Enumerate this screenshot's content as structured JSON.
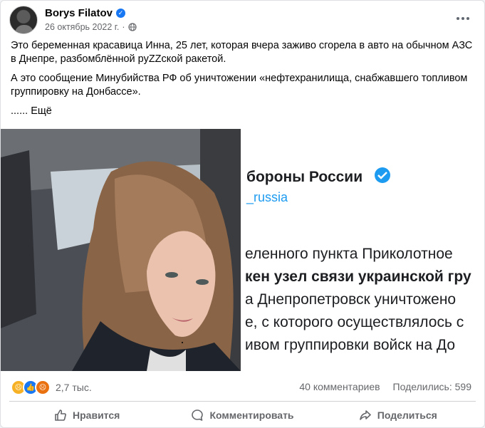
{
  "post": {
    "author": "Borys Filatov",
    "date": "26 октябрь 2022 г.",
    "separator": "·",
    "paragraphs": [
      "Это беременная красавица Инна, 25 лет, которая вчера заживо сгорела в авто на обычном АЗС в Днепре, разбомблённой руZZской ракетой.",
      "А это сообщение Минубийства РФ об уничтожении «нефтехранилища, снабжавшего топливом группировку на Донбассе»."
    ],
    "see_more_dots": "......",
    "see_more_label": "Ещё"
  },
  "screenshot_text": {
    "title": "бороны России",
    "handle": "_russia",
    "lines": [
      "еленного пункта Приколотное",
      "кен узел связи украинской гру",
      "а Днепропетровск уничтожено",
      "е, с которого осуществлялось с",
      "ивом группировки войск на До"
    ]
  },
  "reactions": {
    "count": "2,7 тыс.",
    "comments": "40 комментариев",
    "shares": "Поделились: 599"
  },
  "actions": {
    "like": "Нравится",
    "comment": "Комментировать",
    "share": "Поделиться"
  },
  "colors": {
    "accent": "#1877f2",
    "muted": "#65676b"
  }
}
